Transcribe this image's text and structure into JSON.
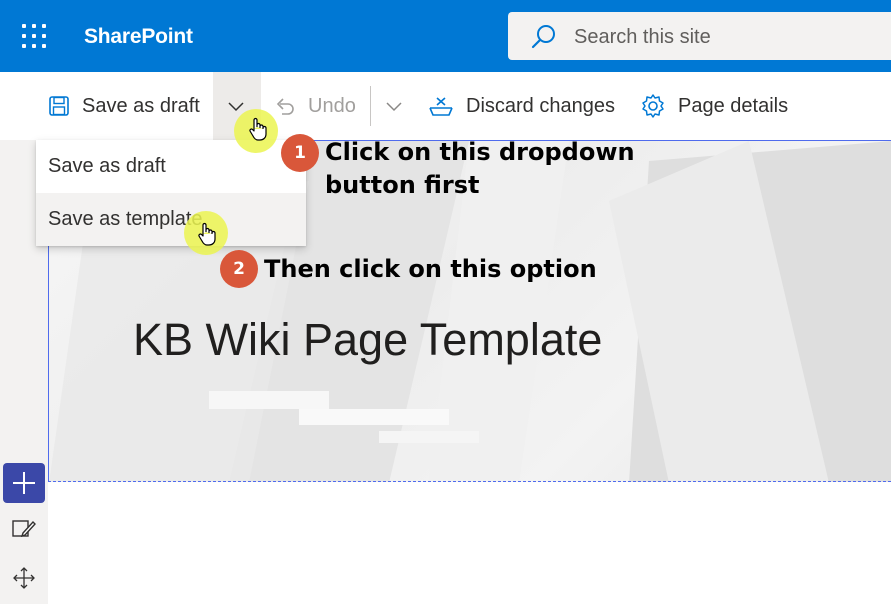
{
  "suite_bar": {
    "app_name": "SharePoint",
    "search_placeholder": "Search this site",
    "color": "#0078d4"
  },
  "command_bar": {
    "save_draft_label": "Save as draft",
    "undo_label": "Undo",
    "discard_label": "Discard changes",
    "page_details_label": "Page details"
  },
  "save_menu": {
    "items": [
      "Save as draft",
      "Save as template"
    ],
    "highlighted_index": 1
  },
  "page": {
    "title": "KB Wiki Page Template"
  },
  "annotations": [
    {
      "number": "1",
      "text_line1": "Click on this dropdown",
      "text_line2": "button first"
    },
    {
      "number": "2",
      "text_line1": "Then click on this option"
    }
  ],
  "colors": {
    "accent": "#0078d4",
    "badge": "#d9573a",
    "add_button": "#3b48a8"
  },
  "icons": [
    "waffle-icon",
    "search-icon",
    "save-icon",
    "chevron-down-icon",
    "undo-icon",
    "discard-icon",
    "gear-icon",
    "plus-icon",
    "edit-icon",
    "move-icon",
    "hand-cursor-icon"
  ]
}
